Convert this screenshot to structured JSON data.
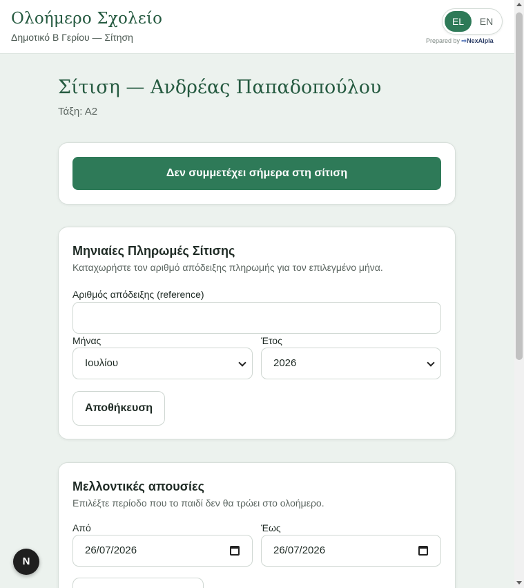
{
  "header": {
    "title": "Ολοήμερο Σχολείο",
    "subtitle": "Δημοτικό Β Γερίου — Σίτηση",
    "languages": [
      "EL",
      "EN"
    ],
    "active_language": "EL",
    "prepared_by": "Prepared by",
    "brand_logo": "NexAIpla"
  },
  "page": {
    "title": "Σίτιση — Ανδρέας Παπαδοπούλου",
    "class_label": "Τάξη: Α2"
  },
  "absent_card": {
    "button_label": "Δεν συμμετέχει σήμερα στη σίτιση"
  },
  "payments": {
    "heading": "Μηνιαίες Πληρωμές Σίτισης",
    "description": "Καταχωρήστε τον αριθμό απόδειξης πληρωμής για τον επιλεγμένο μήνα.",
    "reference_label": "Αριθμός απόδειξης (reference)",
    "reference_value": "",
    "month_label": "Μήνας",
    "month_value": "Ιουλίου",
    "year_label": "Έτος",
    "year_value": "2026",
    "save_label": "Αποθήκευση"
  },
  "future_absences": {
    "heading": "Μελλοντικές απουσίες",
    "description": "Επιλέξτε περίοδο που το παιδί δεν θα τρώει στο ολοήμερο.",
    "from_label": "Από",
    "from_value": "26/07/2026",
    "to_label": "Έως",
    "to_value": "26/07/2026"
  },
  "fab": {
    "label": "N"
  },
  "colors": {
    "accent": "#2e7a58",
    "title": "#255a40",
    "background": "#ecf2ee"
  }
}
